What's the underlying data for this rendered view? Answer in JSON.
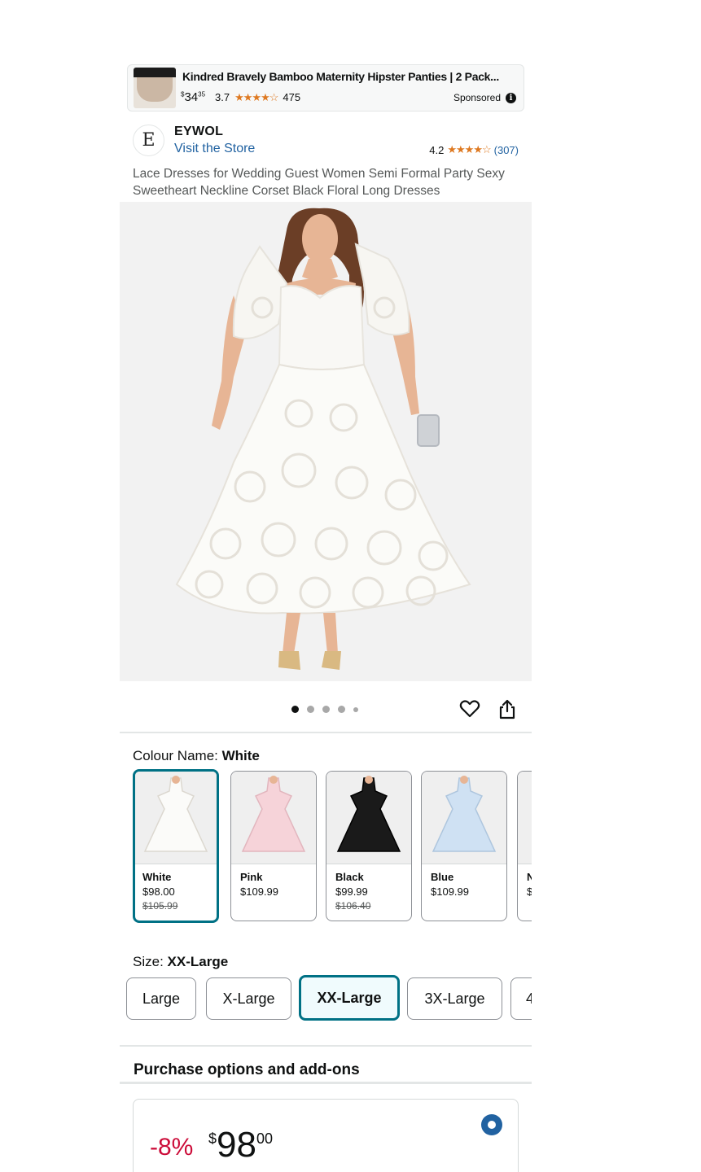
{
  "ad": {
    "title": "Kindred Bravely Bamboo Maternity Hipster Panties | 2 Pack...",
    "price_symbol": "$",
    "price_whole": "34",
    "price_fraction": "35",
    "rating": "3.7",
    "stars": "★★★★☆",
    "review_count": "475",
    "sponsored_label": "Sponsored",
    "info_glyph": "i"
  },
  "brand": {
    "logo_letter": "E",
    "name": "EYWOL",
    "visit_store": "Visit the Store",
    "rating": "4.2",
    "stars": "★★★★☆",
    "review_count": "(307)"
  },
  "product": {
    "title": "Lace Dresses for Wedding Guest Women Semi Formal Party Sexy Sweetheart Neckline Corset Black Floral Long Dresses",
    "image_count": 5,
    "active_image": 1
  },
  "colour": {
    "label": "Colour Name: ",
    "selected": "White",
    "options": [
      {
        "name": "White",
        "price": "$98.00",
        "was": "$105.99",
        "dress_color": "#fbfbf9"
      },
      {
        "name": "Pink",
        "price": "$109.99",
        "was": "",
        "dress_color": "#f6d3d9"
      },
      {
        "name": "Black",
        "price": "$99.99",
        "was": "$106.40",
        "dress_color": "#1a1a1a"
      },
      {
        "name": "Blue",
        "price": "$109.99",
        "was": "",
        "dress_color": "#cfe1f3"
      },
      {
        "name": "N",
        "price": "$",
        "was": "",
        "dress_color": "#e9e9e9"
      }
    ]
  },
  "size": {
    "label": "Size: ",
    "selected": "XX-Large",
    "options": [
      "Large",
      "X-Large",
      "XX-Large",
      "3X-Large",
      "4"
    ]
  },
  "purchase": {
    "title": "Purchase options and add-ons",
    "discount": "-8%",
    "price_symbol": "$",
    "price_whole": "98",
    "price_fraction": "00"
  },
  "colors": {
    "link": "#2162a1",
    "star": "#de7921",
    "selected_border": "#007185",
    "discount": "#cc0c39"
  }
}
